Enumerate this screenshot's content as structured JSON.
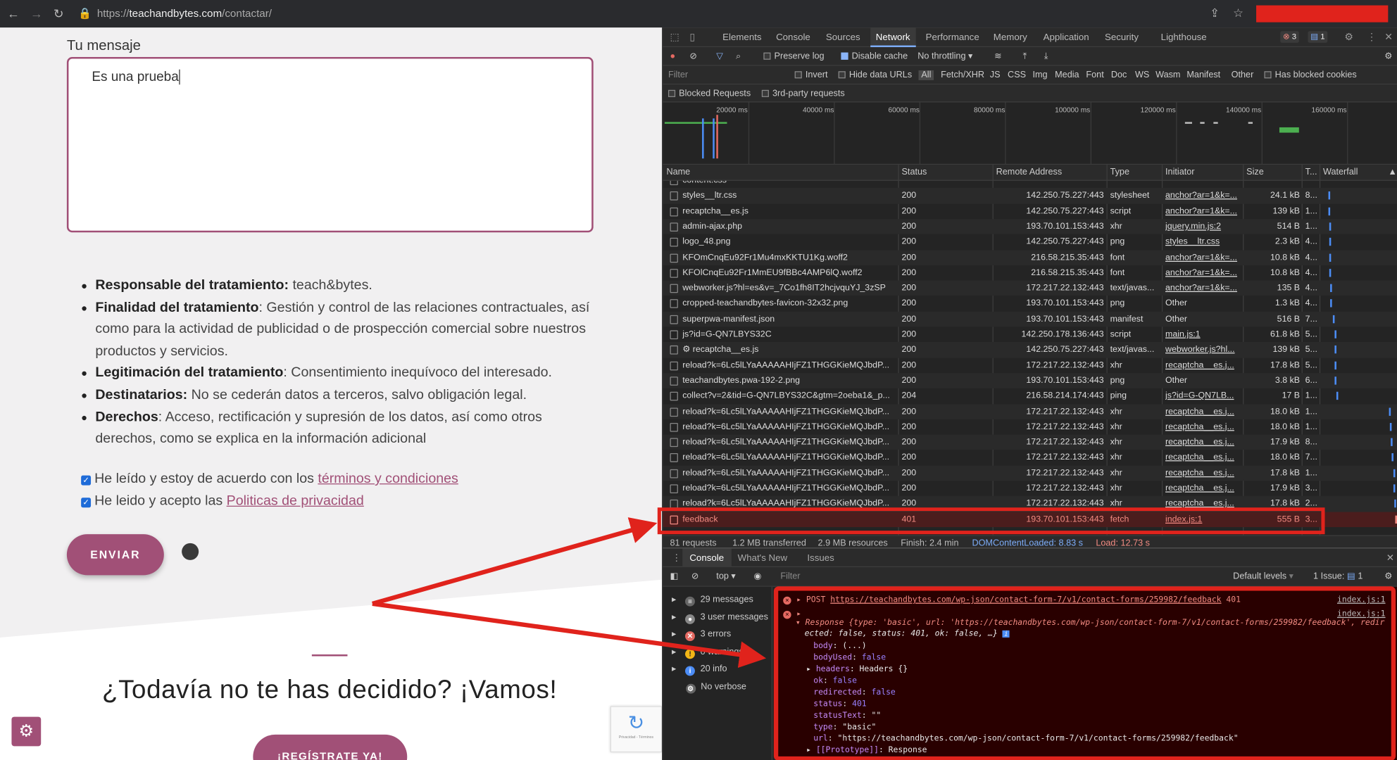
{
  "browser": {
    "url_prefix": "https://",
    "url_host": "teachandbytes.com",
    "url_path": "/contactar/"
  },
  "site": {
    "message_label": "Tu mensaje",
    "message_value": "Es una prueba",
    "legal": [
      {
        "b": "Responsable del tratamiento:",
        "t": " teach&bytes."
      },
      {
        "b": "Finalidad del tratamiento",
        "t": ": Gestión y control de las relaciones contractuales, así como para la actividad de publicidad o de prospección comercial sobre nuestros productos y servicios."
      },
      {
        "b": "Legitimación del tratamiento",
        "t": ": Consentimiento inequívoco del interesado."
      },
      {
        "b": "Destinatarios:",
        "t": " No se cederán datos a terceros, salvo obligación legal."
      },
      {
        "b": "Derechos",
        "t": ": Acceso, rectificación y supresión de los datos, así como otros derechos, como se explica en la información adicional"
      }
    ],
    "check1_text": "He leído y estoy de acuerdo con los ",
    "check1_link": "términos y condiciones",
    "check2_text": "He leido y acepto las ",
    "check2_link": "Politicas de privacidad",
    "send_label": "ENVIAR",
    "headline": "¿Todavía no te has decidido? ¡Vamos!",
    "cta_label": "¡REGÍSTRATE YA!",
    "recaptcha_terms": "Privacidad - Términos"
  },
  "devtools": {
    "tabs": [
      "Elements",
      "Console",
      "Sources",
      "Network",
      "Performance",
      "Memory",
      "Application",
      "Security",
      "Lighthouse"
    ],
    "active_tab": "Network",
    "badge_errors": "3",
    "badge_msgs": "1",
    "preserve_log": "Preserve log",
    "disable_cache": "Disable cache",
    "throttling": "No throttling",
    "filter_placeholder": "Filter",
    "invert": "Invert",
    "hide_data_urls": "Hide data URLs",
    "type_filters": [
      "All",
      "Fetch/XHR",
      "JS",
      "CSS",
      "Img",
      "Media",
      "Font",
      "Doc",
      "WS",
      "Wasm",
      "Manifest",
      "Other"
    ],
    "blocked_cookies": "Has blocked cookies",
    "blocked_requests": "Blocked Requests",
    "third_party": "3rd-party requests",
    "timeline_ticks": [
      "20000 ms",
      "40000 ms",
      "60000 ms",
      "80000 ms",
      "100000 ms",
      "120000 ms",
      "140000 ms",
      "160000 ms"
    ],
    "columns": [
      "Name",
      "Status",
      "Remote Address",
      "Type",
      "Initiator",
      "Size",
      "T...",
      "Waterfall"
    ],
    "requests": [
      {
        "name": "content.css",
        "status": "",
        "addr": "",
        "type": "",
        "init": "",
        "size": "",
        "t": ""
      },
      {
        "name": "styles__ltr.css",
        "status": "200",
        "addr": "142.250.75.227:443",
        "type": "stylesheet",
        "init": "anchor?ar=1&k=...",
        "size": "24.1 kB",
        "t": "8..."
      },
      {
        "name": "recaptcha__es.js",
        "status": "200",
        "addr": "142.250.75.227:443",
        "type": "script",
        "init": "anchor?ar=1&k=...",
        "size": "139 kB",
        "t": "1..."
      },
      {
        "name": "admin-ajax.php",
        "status": "200",
        "addr": "193.70.101.153:443",
        "type": "xhr",
        "init": "jquery.min.js:2",
        "size": "514 B",
        "t": "1..."
      },
      {
        "name": "logo_48.png",
        "status": "200",
        "addr": "142.250.75.227:443",
        "type": "png",
        "init": "styles__ltr.css",
        "size": "2.3 kB",
        "t": "4..."
      },
      {
        "name": "KFOmCnqEu92Fr1Mu4mxKKTU1Kg.woff2",
        "status": "200",
        "addr": "216.58.215.35:443",
        "type": "font",
        "init": "anchor?ar=1&k=...",
        "size": "10.8 kB",
        "t": "4..."
      },
      {
        "name": "KFOlCnqEu92Fr1MmEU9fBBc4AMP6lQ.woff2",
        "status": "200",
        "addr": "216.58.215.35:443",
        "type": "font",
        "init": "anchor?ar=1&k=...",
        "size": "10.8 kB",
        "t": "4..."
      },
      {
        "name": "webworker.js?hl=es&v=_7Co1fh8IT2hcjvquYJ_3zSP",
        "status": "200",
        "addr": "172.217.22.132:443",
        "type": "text/javas...",
        "init": "anchor?ar=1&k=...",
        "size": "135 B",
        "t": "4..."
      },
      {
        "name": "cropped-teachandbytes-favicon-32x32.png",
        "status": "200",
        "addr": "193.70.101.153:443",
        "type": "png",
        "init": "Other",
        "size": "1.3 kB",
        "t": "4..."
      },
      {
        "name": "superpwa-manifest.json",
        "status": "200",
        "addr": "193.70.101.153:443",
        "type": "manifest",
        "init": "Other",
        "size": "516 B",
        "t": "7..."
      },
      {
        "name": "js?id=G-QN7LBYS32C",
        "status": "200",
        "addr": "142.250.178.136:443",
        "type": "script",
        "init": "main.js:1",
        "size": "61.8 kB",
        "t": "5..."
      },
      {
        "name": "⚙ recaptcha__es.js",
        "status": "200",
        "addr": "142.250.75.227:443",
        "type": "text/javas...",
        "init": "webworker.js?hl...",
        "size": "139 kB",
        "t": "5..."
      },
      {
        "name": "reload?k=6Lc5lLYaAAAAAHIjFZ1THGGKieMQJbdP...",
        "status": "200",
        "addr": "172.217.22.132:443",
        "type": "xhr",
        "init": "recaptcha__es.j...",
        "size": "17.8 kB",
        "t": "5..."
      },
      {
        "name": "teachandbytes.pwa-192-2.png",
        "status": "200",
        "addr": "193.70.101.153:443",
        "type": "png",
        "init": "Other",
        "size": "3.8 kB",
        "t": "6..."
      },
      {
        "name": "collect?v=2&tid=G-QN7LBYS32C&gtm=2oeba1&_p...",
        "status": "204",
        "addr": "216.58.214.174:443",
        "type": "ping",
        "init": "js?id=G-QN7LB...",
        "size": "17 B",
        "t": "1..."
      },
      {
        "name": "reload?k=6Lc5lLYaAAAAAHIjFZ1THGGKieMQJbdP...",
        "status": "200",
        "addr": "172.217.22.132:443",
        "type": "xhr",
        "init": "recaptcha__es.j...",
        "size": "18.0 kB",
        "t": "1..."
      },
      {
        "name": "reload?k=6Lc5lLYaAAAAAHIjFZ1THGGKieMQJbdP...",
        "status": "200",
        "addr": "172.217.22.132:443",
        "type": "xhr",
        "init": "recaptcha__es.j...",
        "size": "18.0 kB",
        "t": "1..."
      },
      {
        "name": "reload?k=6Lc5lLYaAAAAAHIjFZ1THGGKieMQJbdP...",
        "status": "200",
        "addr": "172.217.22.132:443",
        "type": "xhr",
        "init": "recaptcha__es.j...",
        "size": "17.9 kB",
        "t": "8..."
      },
      {
        "name": "reload?k=6Lc5lLYaAAAAAHIjFZ1THGGKieMQJbdP...",
        "status": "200",
        "addr": "172.217.22.132:443",
        "type": "xhr",
        "init": "recaptcha__es.j...",
        "size": "18.0 kB",
        "t": "7..."
      },
      {
        "name": "reload?k=6Lc5lLYaAAAAAHIjFZ1THGGKieMQJbdP...",
        "status": "200",
        "addr": "172.217.22.132:443",
        "type": "xhr",
        "init": "recaptcha__es.j...",
        "size": "17.8 kB",
        "t": "1..."
      },
      {
        "name": "reload?k=6Lc5lLYaAAAAAHIjFZ1THGGKieMQJbdP...",
        "status": "200",
        "addr": "172.217.22.132:443",
        "type": "xhr",
        "init": "recaptcha__es.j...",
        "size": "17.9 kB",
        "t": "3..."
      },
      {
        "name": "reload?k=6Lc5lLYaAAAAAHIjFZ1THGGKieMQJbdP...",
        "status": "200",
        "addr": "172.217.22.132:443",
        "type": "xhr",
        "init": "recaptcha__es.j...",
        "size": "17.8 kB",
        "t": "2..."
      },
      {
        "name": "feedback",
        "status": "401",
        "addr": "193.70.101.153:443",
        "type": "fetch",
        "init": "index.js:1",
        "size": "555 B",
        "t": "3...",
        "error": true
      }
    ],
    "summary": {
      "requests": "81 requests",
      "transferred": "1.2 MB transferred",
      "resources": "2.9 MB resources",
      "finish": "Finish: 2.4 min",
      "dcl": "DOMContentLoaded: 8.83 s",
      "load": "Load: 12.73 s"
    },
    "drawer_tabs": [
      "Console",
      "What's New",
      "Issues"
    ],
    "console_context": "top",
    "console_filter": "Filter",
    "default_levels": "Default levels",
    "issues_label": "1 Issue:",
    "issues_count": "1",
    "sidebar": [
      "29 messages",
      "3 user messages",
      "3 errors",
      "0 warnings",
      "20 info",
      "No verbose"
    ],
    "log": {
      "post_method": "POST",
      "post_url": "https://teachandbytes.com/wp-json/contact-form-7/v1/contact-forms/259982/feedback",
      "post_status": "401",
      "source": "index.js:1",
      "response_line1": "Response {type: 'basic', url: 'https://teachandbytes.com/wp-json/contact-form-7/v1/contact-forms/259982/feedback', redir",
      "response_line2": "ected: false, status: 401, ok: false, …}",
      "props": [
        {
          "k": "body",
          "v": "(...)"
        },
        {
          "k": "bodyUsed",
          "v": "false"
        },
        {
          "k": "headers",
          "v": "Headers {}"
        },
        {
          "k": "ok",
          "v": "false"
        },
        {
          "k": "redirected",
          "v": "false"
        },
        {
          "k": "status",
          "v": "401"
        },
        {
          "k": "statusText",
          "v": "\"\""
        },
        {
          "k": "type",
          "v": "\"basic\""
        },
        {
          "k": "url",
          "v": "\"https://teachandbytes.com/wp-json/contact-form-7/v1/contact-forms/259982/feedback\""
        },
        {
          "k": "[[Prototype]]",
          "v": "Response"
        }
      ]
    }
  },
  "colors": {
    "brand": "#a15077",
    "annotation": "#e0231c"
  }
}
